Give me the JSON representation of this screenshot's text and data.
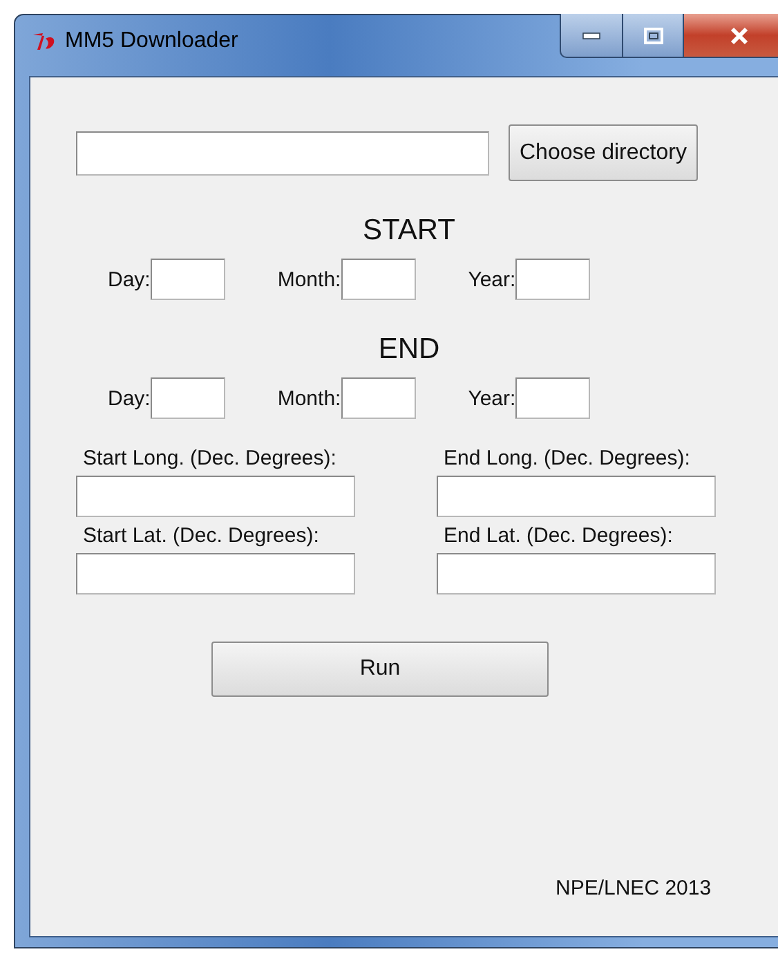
{
  "window": {
    "title": "MM5 Downloader"
  },
  "directory": {
    "button": "Choose directory"
  },
  "start": {
    "heading": "START",
    "fields": [
      {
        "label": "Day:"
      },
      {
        "label": "Month:"
      },
      {
        "label": "Year:"
      }
    ]
  },
  "end": {
    "heading": "END",
    "fields": [
      {
        "label": "Day:"
      },
      {
        "label": "Month:"
      },
      {
        "label": "Year:"
      }
    ]
  },
  "coordinates": [
    {
      "label": "Start Long. (Dec. Degrees):"
    },
    {
      "label": "End Long. (Dec. Degrees):"
    },
    {
      "label": "Start Lat. (Dec. Degrees):"
    },
    {
      "label": "End Lat. (Dec. Degrees):"
    }
  ],
  "run_button": "Run",
  "footer": "NPE/LNEC 2013"
}
